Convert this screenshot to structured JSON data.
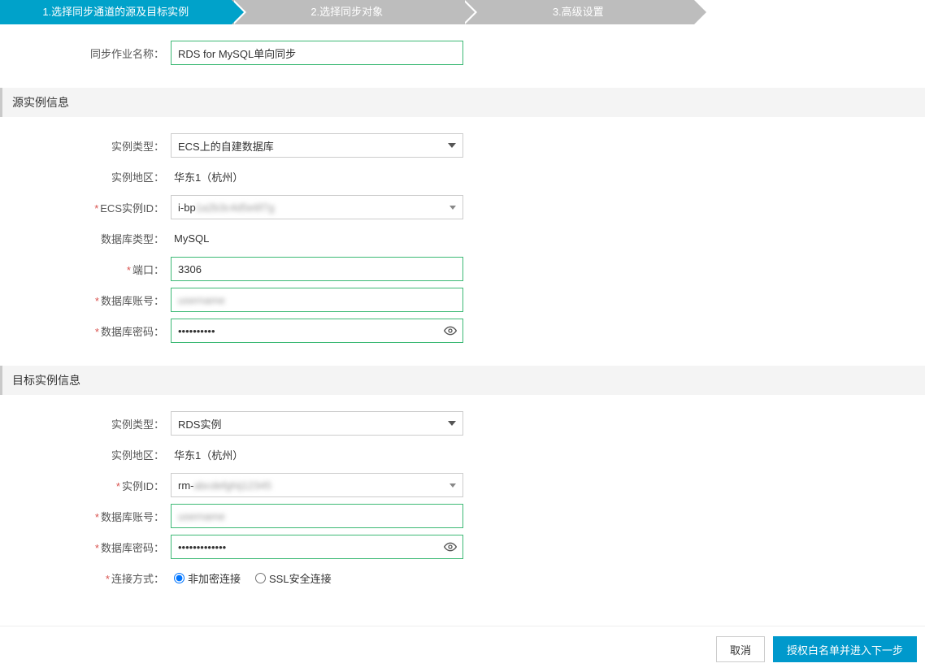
{
  "steps": {
    "s1": "1.选择同步通道的源及目标实例",
    "s2": "2.选择同步对象",
    "s3": "3.高级设置",
    "s4": ""
  },
  "top": {
    "job_name_label": "同步作业名称：",
    "job_name_value": "RDS for MySQL单向同步"
  },
  "source": {
    "header": "源实例信息",
    "instance_type_label": "实例类型：",
    "instance_type_value": "ECS上的自建数据库",
    "region_label": "实例地区：",
    "region_value": "华东1（杭州）",
    "ecs_id_label": "ECS实例ID：",
    "ecs_id_value": "i-bp",
    "db_type_label": "数据库类型：",
    "db_type_value": "MySQL",
    "port_label": "端口：",
    "port_value": "3306",
    "db_user_label": "数据库账号：",
    "db_user_value": "username",
    "db_pass_label": "数据库密码：",
    "db_pass_value": "••••••••••"
  },
  "target": {
    "header": "目标实例信息",
    "instance_type_label": "实例类型：",
    "instance_type_value": "RDS实例",
    "region_label": "实例地区：",
    "region_value": "华东1（杭州）",
    "instance_id_label": "实例ID：",
    "instance_id_value": "rm-",
    "db_user_label": "数据库账号：",
    "db_user_value": "username",
    "db_pass_label": "数据库密码：",
    "db_pass_value": "•••••••••••••",
    "conn_mode_label": "连接方式：",
    "conn_mode_non_encrypted": "非加密连接",
    "conn_mode_ssl": "SSL安全连接"
  },
  "footer": {
    "cancel": "取消",
    "next": "授权白名单并进入下一步"
  }
}
